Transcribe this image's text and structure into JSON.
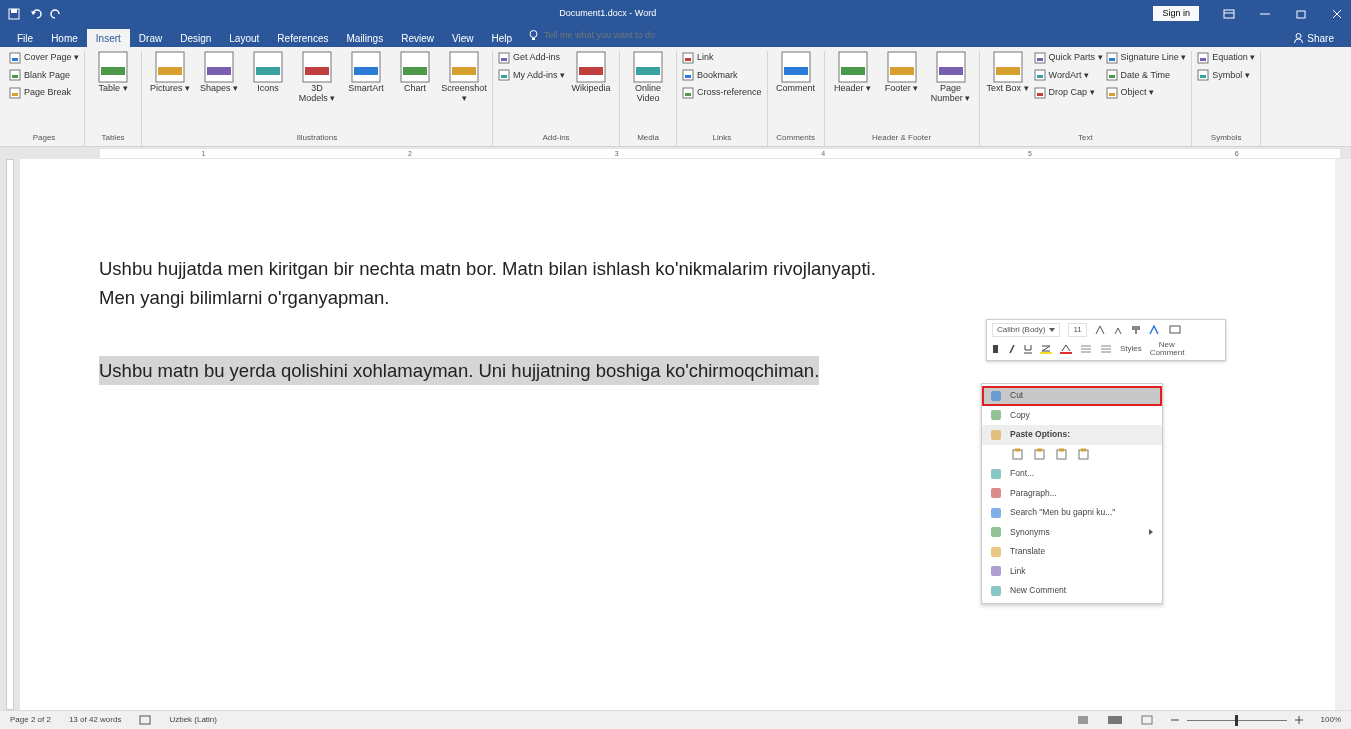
{
  "window": {
    "title": "Document1.docx - Word",
    "sign_in": "Sign in"
  },
  "tabs": [
    {
      "label": "File",
      "selected": false
    },
    {
      "label": "Home",
      "selected": false
    },
    {
      "label": "Insert",
      "selected": true
    },
    {
      "label": "Draw",
      "selected": false
    },
    {
      "label": "Design",
      "selected": false
    },
    {
      "label": "Layout",
      "selected": false
    },
    {
      "label": "References",
      "selected": false
    },
    {
      "label": "Mailings",
      "selected": false
    },
    {
      "label": "Review",
      "selected": false
    },
    {
      "label": "View",
      "selected": false
    },
    {
      "label": "Help",
      "selected": false
    }
  ],
  "tell_me": {
    "placeholder": "Tell me what you want to do"
  },
  "share": "Share",
  "ribbon": [
    {
      "name": "Pages",
      "items": [
        {
          "kind": "small",
          "label": "Cover Page ▾"
        },
        {
          "kind": "small",
          "label": "Blank Page"
        },
        {
          "kind": "small",
          "label": "Page Break"
        }
      ]
    },
    {
      "name": "Tables",
      "items": [
        {
          "kind": "large",
          "label": "Table ▾"
        }
      ]
    },
    {
      "name": "Illustrations",
      "items": [
        {
          "kind": "large",
          "label": "Pictures ▾"
        },
        {
          "kind": "large",
          "label": "Shapes ▾"
        },
        {
          "kind": "large",
          "label": "Icons"
        },
        {
          "kind": "large",
          "label": "3D Models ▾"
        },
        {
          "kind": "large",
          "label": "SmartArt"
        },
        {
          "kind": "large",
          "label": "Chart"
        },
        {
          "kind": "large",
          "label": "Screenshot ▾"
        }
      ]
    },
    {
      "name": "Add-ins",
      "items": [
        {
          "kind": "small",
          "label": "Get Add-ins"
        },
        {
          "kind": "small",
          "label": "My Add-ins ▾"
        },
        {
          "kind": "large",
          "label": "Wikipedia"
        }
      ]
    },
    {
      "name": "Media",
      "items": [
        {
          "kind": "large",
          "label": "Online Video"
        }
      ]
    },
    {
      "name": "Links",
      "items": [
        {
          "kind": "small",
          "label": "Link"
        },
        {
          "kind": "small",
          "label": "Bookmark"
        },
        {
          "kind": "small",
          "label": "Cross-reference"
        }
      ]
    },
    {
      "name": "Comments",
      "items": [
        {
          "kind": "large",
          "label": "Comment"
        }
      ]
    },
    {
      "name": "Header & Footer",
      "items": [
        {
          "kind": "large",
          "label": "Header ▾"
        },
        {
          "kind": "large",
          "label": "Footer ▾"
        },
        {
          "kind": "large",
          "label": "Page Number ▾"
        }
      ]
    },
    {
      "name": "Text",
      "items": [
        {
          "kind": "large",
          "label": "Text Box ▾"
        },
        {
          "kind": "small",
          "label": "Quick Parts ▾"
        },
        {
          "kind": "small",
          "label": "WordArt ▾"
        },
        {
          "kind": "small",
          "label": "Drop Cap ▾"
        },
        {
          "kind": "small",
          "label": "Signature Line ▾"
        },
        {
          "kind": "small",
          "label": "Date & Time"
        },
        {
          "kind": "small",
          "label": "Object ▾"
        }
      ]
    },
    {
      "name": "Symbols",
      "items": [
        {
          "kind": "small",
          "label": "Equation ▾"
        },
        {
          "kind": "small",
          "label": "Symbol ▾"
        }
      ]
    }
  ],
  "ruler_numbers": [
    "1",
    "2",
    "3",
    "4",
    "5",
    "6"
  ],
  "document": {
    "paragraphs": [
      {
        "lines": [
          "Ushbu hujjatda men kiritgan bir nechta matn bor. Matn bilan ishlash ko'nikmalarim rivojlanyapti.",
          "Men yangi bilimlarni o'rganyapman."
        ],
        "selected": false
      },
      {
        "lines": [
          "Ushbu matn bu yerda qolishini xohlamayman. Uni hujjatning boshiga ko'chirmoqchiman."
        ],
        "selected": true
      }
    ]
  },
  "mini_toolbar": {
    "font": "Calibri (Body)",
    "size": "11",
    "styles": "Styles",
    "new_comment": "New Comment"
  },
  "context_menu": [
    {
      "kind": "item",
      "label": "Cut",
      "selected": true
    },
    {
      "kind": "item",
      "label": "Copy",
      "selected": false
    },
    {
      "kind": "header",
      "label": "Paste Options:",
      "selected": false
    },
    {
      "kind": "paste",
      "selected": false
    },
    {
      "kind": "item",
      "label": "Font...",
      "selected": false
    },
    {
      "kind": "item",
      "label": "Paragraph...",
      "selected": false
    },
    {
      "kind": "item",
      "label": "Search \"Men bu gapni ku...\"",
      "selected": false
    },
    {
      "kind": "submenu",
      "label": "Synonyms",
      "selected": false
    },
    {
      "kind": "item",
      "label": "Translate",
      "selected": false
    },
    {
      "kind": "item",
      "label": "Link",
      "selected": false
    },
    {
      "kind": "item",
      "label": "New Comment",
      "selected": false
    }
  ],
  "status_bar": {
    "page": "Page 2 of 2",
    "words": "13 of 42 words",
    "language": "Uzbek (Latin)",
    "zoom": "100%",
    "zoom_slider": {
      "level": 0.5
    }
  }
}
